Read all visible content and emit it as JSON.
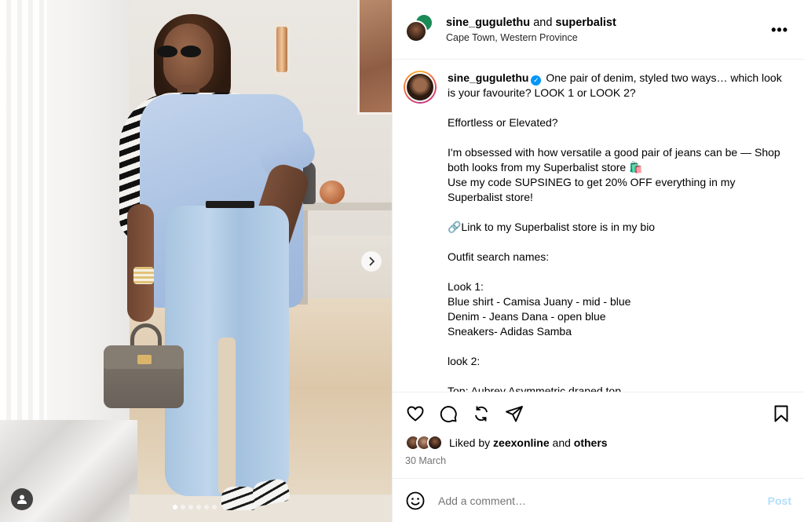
{
  "header": {
    "username": "sine_gugulethu",
    "joiner": "and",
    "collaborator": "superbalist",
    "location": "Cape Town, Western Province",
    "more_label": "•••"
  },
  "caption": {
    "username": "sine_gugulethu",
    "verified_badge": "✓",
    "text": " One pair of denim, styled two ways… which look is your favourite? LOOK 1 or LOOK 2?\n\nEffortless or Elevated?\n\nI'm obsessed with how versatile a good pair of jeans can be — Shop both looks from my Superbalist store 🛍️\nUse my code SUPSINEG to get 20% OFF everything in my Superbalist store!\n\n🔗Link to my Superbalist store is in my bio\n\nOutfit search names:\n\nLook 1:\nBlue shirt - Camisa Juany - mid - blue\nDenim - Jeans Dana - open blue\nSneakers- Adidas Samba\n\nlook 2:\n\nTop: Aubrey Asymmetric draped top"
  },
  "actions": {
    "icons": [
      "heart-icon",
      "comment-icon",
      "repost-icon",
      "share-icon",
      "bookmark-icon"
    ]
  },
  "likes": {
    "prefix": "Liked by",
    "user": "zeexonline",
    "joiner": "and",
    "others": "others",
    "date": "30 March"
  },
  "comment": {
    "emoji_icon": "emoji-icon",
    "placeholder": "Add a comment…",
    "post_label": "Post"
  },
  "media": {
    "carousel_count": 6,
    "active_index": 0
  },
  "colors": {
    "accent_blue": "#0095f6",
    "post_disabled": "#b2dffc",
    "muted_text": "#737373",
    "collab_green": "#1b8a57"
  }
}
